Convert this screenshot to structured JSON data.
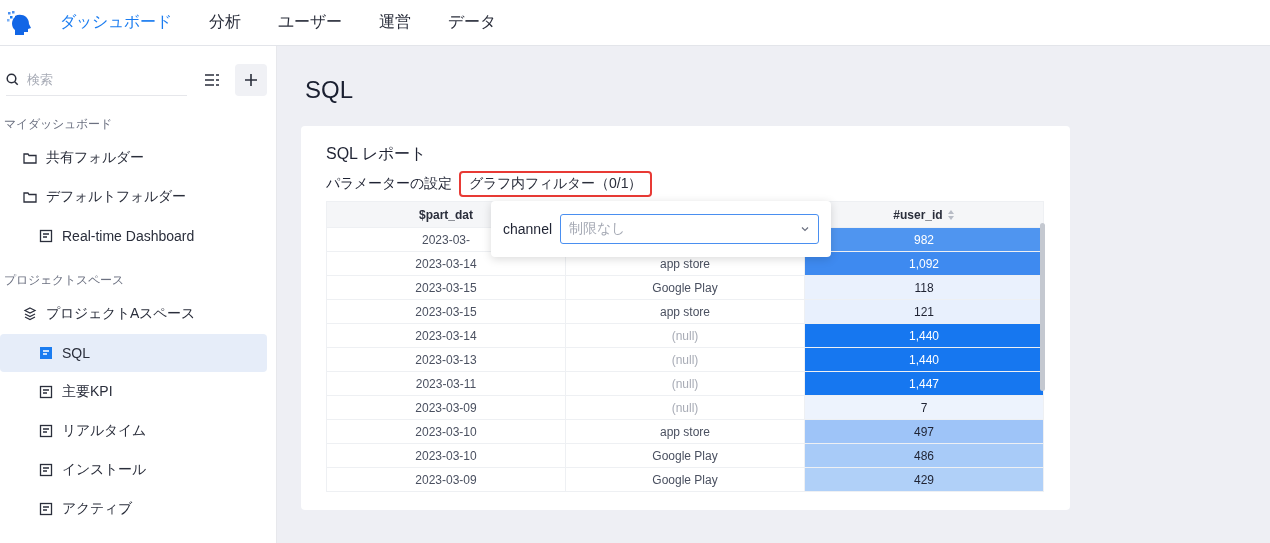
{
  "nav": {
    "tabs": [
      {
        "label": "ダッシュボード",
        "selected": true
      },
      {
        "label": "分析",
        "selected": false
      },
      {
        "label": "ユーザー",
        "selected": false
      },
      {
        "label": "運営",
        "selected": false
      },
      {
        "label": "データ",
        "selected": false
      }
    ]
  },
  "sidebar": {
    "search": {
      "placeholder": "検索"
    },
    "sections": [
      {
        "title": "マイダッシュボード",
        "items": [
          {
            "kind": "folder",
            "label": "共有フォルダー",
            "selected": false
          },
          {
            "kind": "folder",
            "label": "デフォルトフォルダー",
            "selected": false,
            "children": [
              {
                "kind": "doc",
                "label": "Real-time Dashboard",
                "selected": false
              }
            ]
          }
        ]
      },
      {
        "title": "プロジェクトスペース",
        "items": [
          {
            "kind": "space",
            "label": "プロジェクトAスペース",
            "selected": false,
            "children": [
              {
                "kind": "doc",
                "label": "SQL",
                "selected": true
              },
              {
                "kind": "doc",
                "label": "主要KPI",
                "selected": false
              },
              {
                "kind": "doc",
                "label": "リアルタイム",
                "selected": false
              },
              {
                "kind": "doc",
                "label": "インストール",
                "selected": false
              },
              {
                "kind": "doc",
                "label": "アクティブ",
                "selected": false
              }
            ]
          }
        ]
      }
    ]
  },
  "page_title": "SQL",
  "report": {
    "title": "SQL レポート",
    "params_label": "パラメーターの設定",
    "filter_label": "グラフ内フィルター（0/1）",
    "filter_popover": {
      "label": "channel",
      "placeholder": "制限なし"
    },
    "table": {
      "columns": [
        "$part_dat",
        "",
        "#user_id"
      ],
      "rows": [
        {
          "date": "2023-03-",
          "channel": "",
          "user_id": "982",
          "color": "#4f95f0"
        },
        {
          "date": "2023-03-14",
          "channel": "app store",
          "user_id": "1,092",
          "color": "#3e8af0"
        },
        {
          "date": "2023-03-15",
          "channel": "Google Play",
          "user_id": "118",
          "color": "#eaf1fd"
        },
        {
          "date": "2023-03-15",
          "channel": "app store",
          "user_id": "121",
          "color": "#e8f0fd"
        },
        {
          "date": "2023-03-14",
          "channel": "(null)",
          "user_id": "1,440",
          "color": "#1677f0"
        },
        {
          "date": "2023-03-13",
          "channel": "(null)",
          "user_id": "1,440",
          "color": "#1677f0"
        },
        {
          "date": "2023-03-11",
          "channel": "(null)",
          "user_id": "1,447",
          "color": "#1677f0"
        },
        {
          "date": "2023-03-09",
          "channel": "(null)",
          "user_id": "7",
          "color": "#edf3fd"
        },
        {
          "date": "2023-03-10",
          "channel": "app store",
          "user_id": "497",
          "color": "#9ec4f8"
        },
        {
          "date": "2023-03-10",
          "channel": "Google Play",
          "user_id": "486",
          "color": "#a8cbf8"
        },
        {
          "date": "2023-03-09",
          "channel": "Google Play",
          "user_id": "429",
          "color": "#b0d0f8"
        }
      ]
    }
  }
}
